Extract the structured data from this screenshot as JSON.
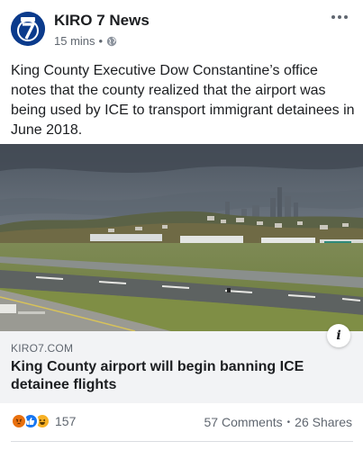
{
  "post": {
    "page_name": "KIRO 7 News",
    "time": "15 mins",
    "separator": "•",
    "text": "King County Executive Dow Constantine’s office notes that the county realized that the airport was being used by ICE to transport immigrant detainees in June 2018.",
    "avatar_icon": "kiro7-logo-icon",
    "privacy_icon": "globe-icon"
  },
  "link": {
    "domain": "KIRO7.COM",
    "title": "King County airport will begin banning ICE detainee flights",
    "image_icon": "airport-runway-photo"
  },
  "stats": {
    "reaction_count": "157",
    "reactions": [
      "angry-reaction-icon",
      "like-reaction-icon",
      "haha-reaction-icon"
    ],
    "comments": "57 Comments",
    "separator": "•",
    "shares": "26 Shares"
  },
  "colors": {
    "brand_blue": "#0b3b8c",
    "like_blue": "#1877f2",
    "angry_orange": "#e9710f",
    "haha_yellow": "#f7b125"
  }
}
